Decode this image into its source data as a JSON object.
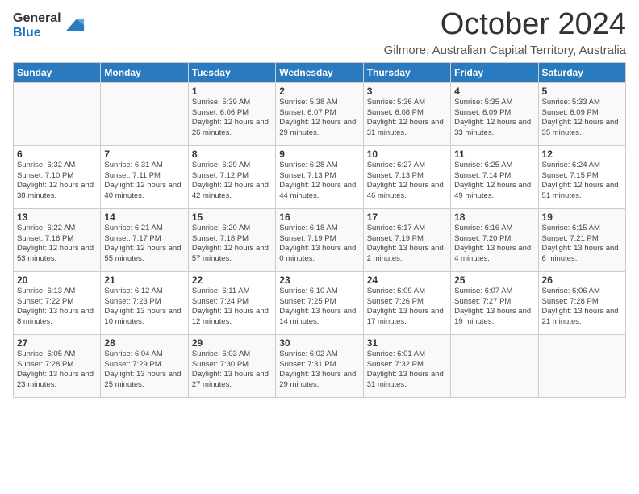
{
  "logo": {
    "general": "General",
    "blue": "Blue"
  },
  "title": "October 2024",
  "location": "Gilmore, Australian Capital Territory, Australia",
  "days_of_week": [
    "Sunday",
    "Monday",
    "Tuesday",
    "Wednesday",
    "Thursday",
    "Friday",
    "Saturday"
  ],
  "weeks": [
    [
      {
        "day": "",
        "info": ""
      },
      {
        "day": "",
        "info": ""
      },
      {
        "day": "1",
        "info": "Sunrise: 5:39 AM\nSunset: 6:06 PM\nDaylight: 12 hours\nand 26 minutes."
      },
      {
        "day": "2",
        "info": "Sunrise: 5:38 AM\nSunset: 6:07 PM\nDaylight: 12 hours\nand 29 minutes."
      },
      {
        "day": "3",
        "info": "Sunrise: 5:36 AM\nSunset: 6:08 PM\nDaylight: 12 hours\nand 31 minutes."
      },
      {
        "day": "4",
        "info": "Sunrise: 5:35 AM\nSunset: 6:09 PM\nDaylight: 12 hours\nand 33 minutes."
      },
      {
        "day": "5",
        "info": "Sunrise: 5:33 AM\nSunset: 6:09 PM\nDaylight: 12 hours\nand 35 minutes."
      }
    ],
    [
      {
        "day": "6",
        "info": "Sunrise: 6:32 AM\nSunset: 7:10 PM\nDaylight: 12 hours\nand 38 minutes."
      },
      {
        "day": "7",
        "info": "Sunrise: 6:31 AM\nSunset: 7:11 PM\nDaylight: 12 hours\nand 40 minutes."
      },
      {
        "day": "8",
        "info": "Sunrise: 6:29 AM\nSunset: 7:12 PM\nDaylight: 12 hours\nand 42 minutes."
      },
      {
        "day": "9",
        "info": "Sunrise: 6:28 AM\nSunset: 7:13 PM\nDaylight: 12 hours\nand 44 minutes."
      },
      {
        "day": "10",
        "info": "Sunrise: 6:27 AM\nSunset: 7:13 PM\nDaylight: 12 hours\nand 46 minutes."
      },
      {
        "day": "11",
        "info": "Sunrise: 6:25 AM\nSunset: 7:14 PM\nDaylight: 12 hours\nand 49 minutes."
      },
      {
        "day": "12",
        "info": "Sunrise: 6:24 AM\nSunset: 7:15 PM\nDaylight: 12 hours\nand 51 minutes."
      }
    ],
    [
      {
        "day": "13",
        "info": "Sunrise: 6:22 AM\nSunset: 7:16 PM\nDaylight: 12 hours\nand 53 minutes."
      },
      {
        "day": "14",
        "info": "Sunrise: 6:21 AM\nSunset: 7:17 PM\nDaylight: 12 hours\nand 55 minutes."
      },
      {
        "day": "15",
        "info": "Sunrise: 6:20 AM\nSunset: 7:18 PM\nDaylight: 12 hours\nand 57 minutes."
      },
      {
        "day": "16",
        "info": "Sunrise: 6:18 AM\nSunset: 7:19 PM\nDaylight: 13 hours\nand 0 minutes."
      },
      {
        "day": "17",
        "info": "Sunrise: 6:17 AM\nSunset: 7:19 PM\nDaylight: 13 hours\nand 2 minutes."
      },
      {
        "day": "18",
        "info": "Sunrise: 6:16 AM\nSunset: 7:20 PM\nDaylight: 13 hours\nand 4 minutes."
      },
      {
        "day": "19",
        "info": "Sunrise: 6:15 AM\nSunset: 7:21 PM\nDaylight: 13 hours\nand 6 minutes."
      }
    ],
    [
      {
        "day": "20",
        "info": "Sunrise: 6:13 AM\nSunset: 7:22 PM\nDaylight: 13 hours\nand 8 minutes."
      },
      {
        "day": "21",
        "info": "Sunrise: 6:12 AM\nSunset: 7:23 PM\nDaylight: 13 hours\nand 10 minutes."
      },
      {
        "day": "22",
        "info": "Sunrise: 6:11 AM\nSunset: 7:24 PM\nDaylight: 13 hours\nand 12 minutes."
      },
      {
        "day": "23",
        "info": "Sunrise: 6:10 AM\nSunset: 7:25 PM\nDaylight: 13 hours\nand 14 minutes."
      },
      {
        "day": "24",
        "info": "Sunrise: 6:09 AM\nSunset: 7:26 PM\nDaylight: 13 hours\nand 17 minutes."
      },
      {
        "day": "25",
        "info": "Sunrise: 6:07 AM\nSunset: 7:27 PM\nDaylight: 13 hours\nand 19 minutes."
      },
      {
        "day": "26",
        "info": "Sunrise: 6:06 AM\nSunset: 7:28 PM\nDaylight: 13 hours\nand 21 minutes."
      }
    ],
    [
      {
        "day": "27",
        "info": "Sunrise: 6:05 AM\nSunset: 7:28 PM\nDaylight: 13 hours\nand 23 minutes."
      },
      {
        "day": "28",
        "info": "Sunrise: 6:04 AM\nSunset: 7:29 PM\nDaylight: 13 hours\nand 25 minutes."
      },
      {
        "day": "29",
        "info": "Sunrise: 6:03 AM\nSunset: 7:30 PM\nDaylight: 13 hours\nand 27 minutes."
      },
      {
        "day": "30",
        "info": "Sunrise: 6:02 AM\nSunset: 7:31 PM\nDaylight: 13 hours\nand 29 minutes."
      },
      {
        "day": "31",
        "info": "Sunrise: 6:01 AM\nSunset: 7:32 PM\nDaylight: 13 hours\nand 31 minutes."
      },
      {
        "day": "",
        "info": ""
      },
      {
        "day": "",
        "info": ""
      }
    ]
  ]
}
